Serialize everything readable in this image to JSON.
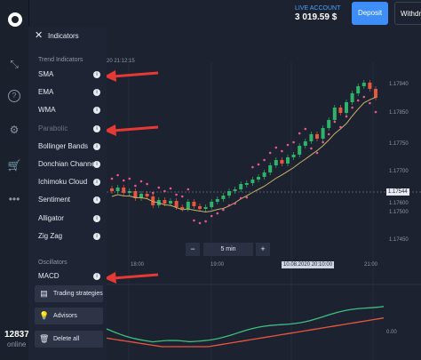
{
  "header": {
    "account_label": "LIVE ACCOUNT",
    "balance": "3 019.59 $",
    "deposit_label": "Deposit",
    "withdraw_label": "Withdr"
  },
  "sidebar": {
    "online_count": "12837",
    "online_label": "online",
    "notification_count": "?"
  },
  "indicators_panel": {
    "title": "Indicators",
    "trend_section": "Trend Indicators",
    "trend_items": [
      "SMA",
      "EMA",
      "WMA",
      "Parabolic",
      "Bollinger Bands",
      "Donchian Channel",
      "Ichimoku Cloud",
      "Sentiment",
      "Alligator",
      "Zig Zag"
    ],
    "oscillators_section": "Oscillators",
    "oscillator_items": [
      "MACD"
    ]
  },
  "tools": {
    "trading_strategies": "Trading strategies",
    "advisors": "Advisors",
    "delete_all": "Delete all"
  },
  "chart": {
    "header_timestamp": "20 21:12:15",
    "price_ticks": [
      "1.17940",
      "1.17850",
      "1.17750",
      "1.17700",
      "1.17600",
      "1.17500",
      "1.17450"
    ],
    "current_price": "1.17544",
    "time_ticks": [
      "18:00",
      "19:00",
      "21:00"
    ],
    "date_tag": "10.08.2020 20:10:00",
    "timeframe": "5 min",
    "minus": "−",
    "plus": "+",
    "oscillator_value": "0.00"
  },
  "colors": {
    "up": "#2fb36a",
    "down": "#e8563d",
    "sar": "#e8588f",
    "accent": "#3d8ef8",
    "arrow": "#e53935"
  }
}
